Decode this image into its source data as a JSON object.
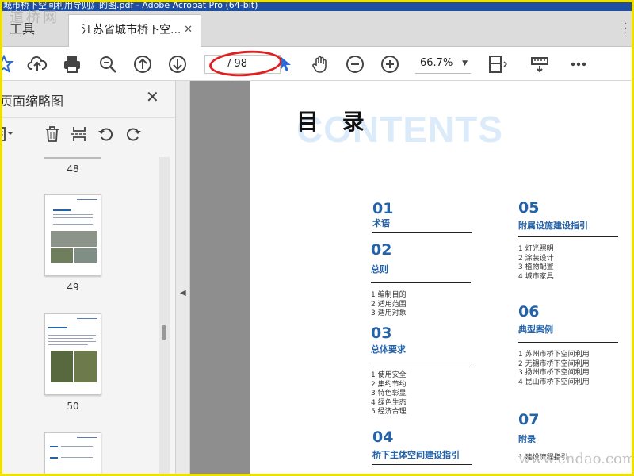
{
  "window": {
    "title": "城市桥下空间利用导则》的图.pdf - Adobe Acrobat Pro (64-bit)",
    "watermark_top": "道桥网"
  },
  "tabs": {
    "tools_label": "工具",
    "doc_label": "江苏省城市桥下空...",
    "close_glyph": "✕"
  },
  "toolbar": {
    "page_indicator": "/ 98",
    "zoom": "66.7%",
    "icons": [
      "star-icon",
      "cloud-upload-icon",
      "print-icon",
      "search-zoom-icon",
      "prev-page-icon",
      "next-page-icon",
      "select-cursor-icon",
      "hand-icon",
      "zoom-out-icon",
      "zoom-in-icon",
      "fit-page-icon",
      "scroll-mode-icon",
      "more-icon"
    ]
  },
  "sidebar": {
    "title": "页面缩略图",
    "close_glyph": "✕",
    "thumbnails": [
      {
        "label": "48"
      },
      {
        "label": "49"
      },
      {
        "label": "50"
      },
      {
        "label": ""
      }
    ]
  },
  "document": {
    "heading": "目 录",
    "heading_bg": "CONTENTS",
    "sections": [
      {
        "num": "01",
        "title": "术语",
        "items": []
      },
      {
        "num": "02",
        "title": "总则",
        "items": [
          "1 编制目的",
          "2 适用范围",
          "3 适用对象"
        ]
      },
      {
        "num": "03",
        "title": "总体要求",
        "items": [
          "1 使用安全",
          "2 集约节约",
          "3 特色彰显",
          "4 绿色生态",
          "5 经济合理"
        ]
      },
      {
        "num": "04",
        "title": "桥下主体空间建设指引",
        "items": []
      },
      {
        "num": "05",
        "title": "附属设施建设指引",
        "items": [
          "1 灯光照明",
          "2 涂装设计",
          "3 植物配置",
          "4 城市家具"
        ]
      },
      {
        "num": "06",
        "title": "典型案例",
        "items": [
          "1 苏州市桥下空间利用",
          "2 无锡市桥下空间利用",
          "3 扬州市桥下空间利用",
          "4 昆山市桥下空间利用"
        ]
      },
      {
        "num": "07",
        "title": "附录",
        "items": [
          "1 建设流程指引"
        ]
      }
    ]
  },
  "watermark_bottom": "www.cndao.com"
}
